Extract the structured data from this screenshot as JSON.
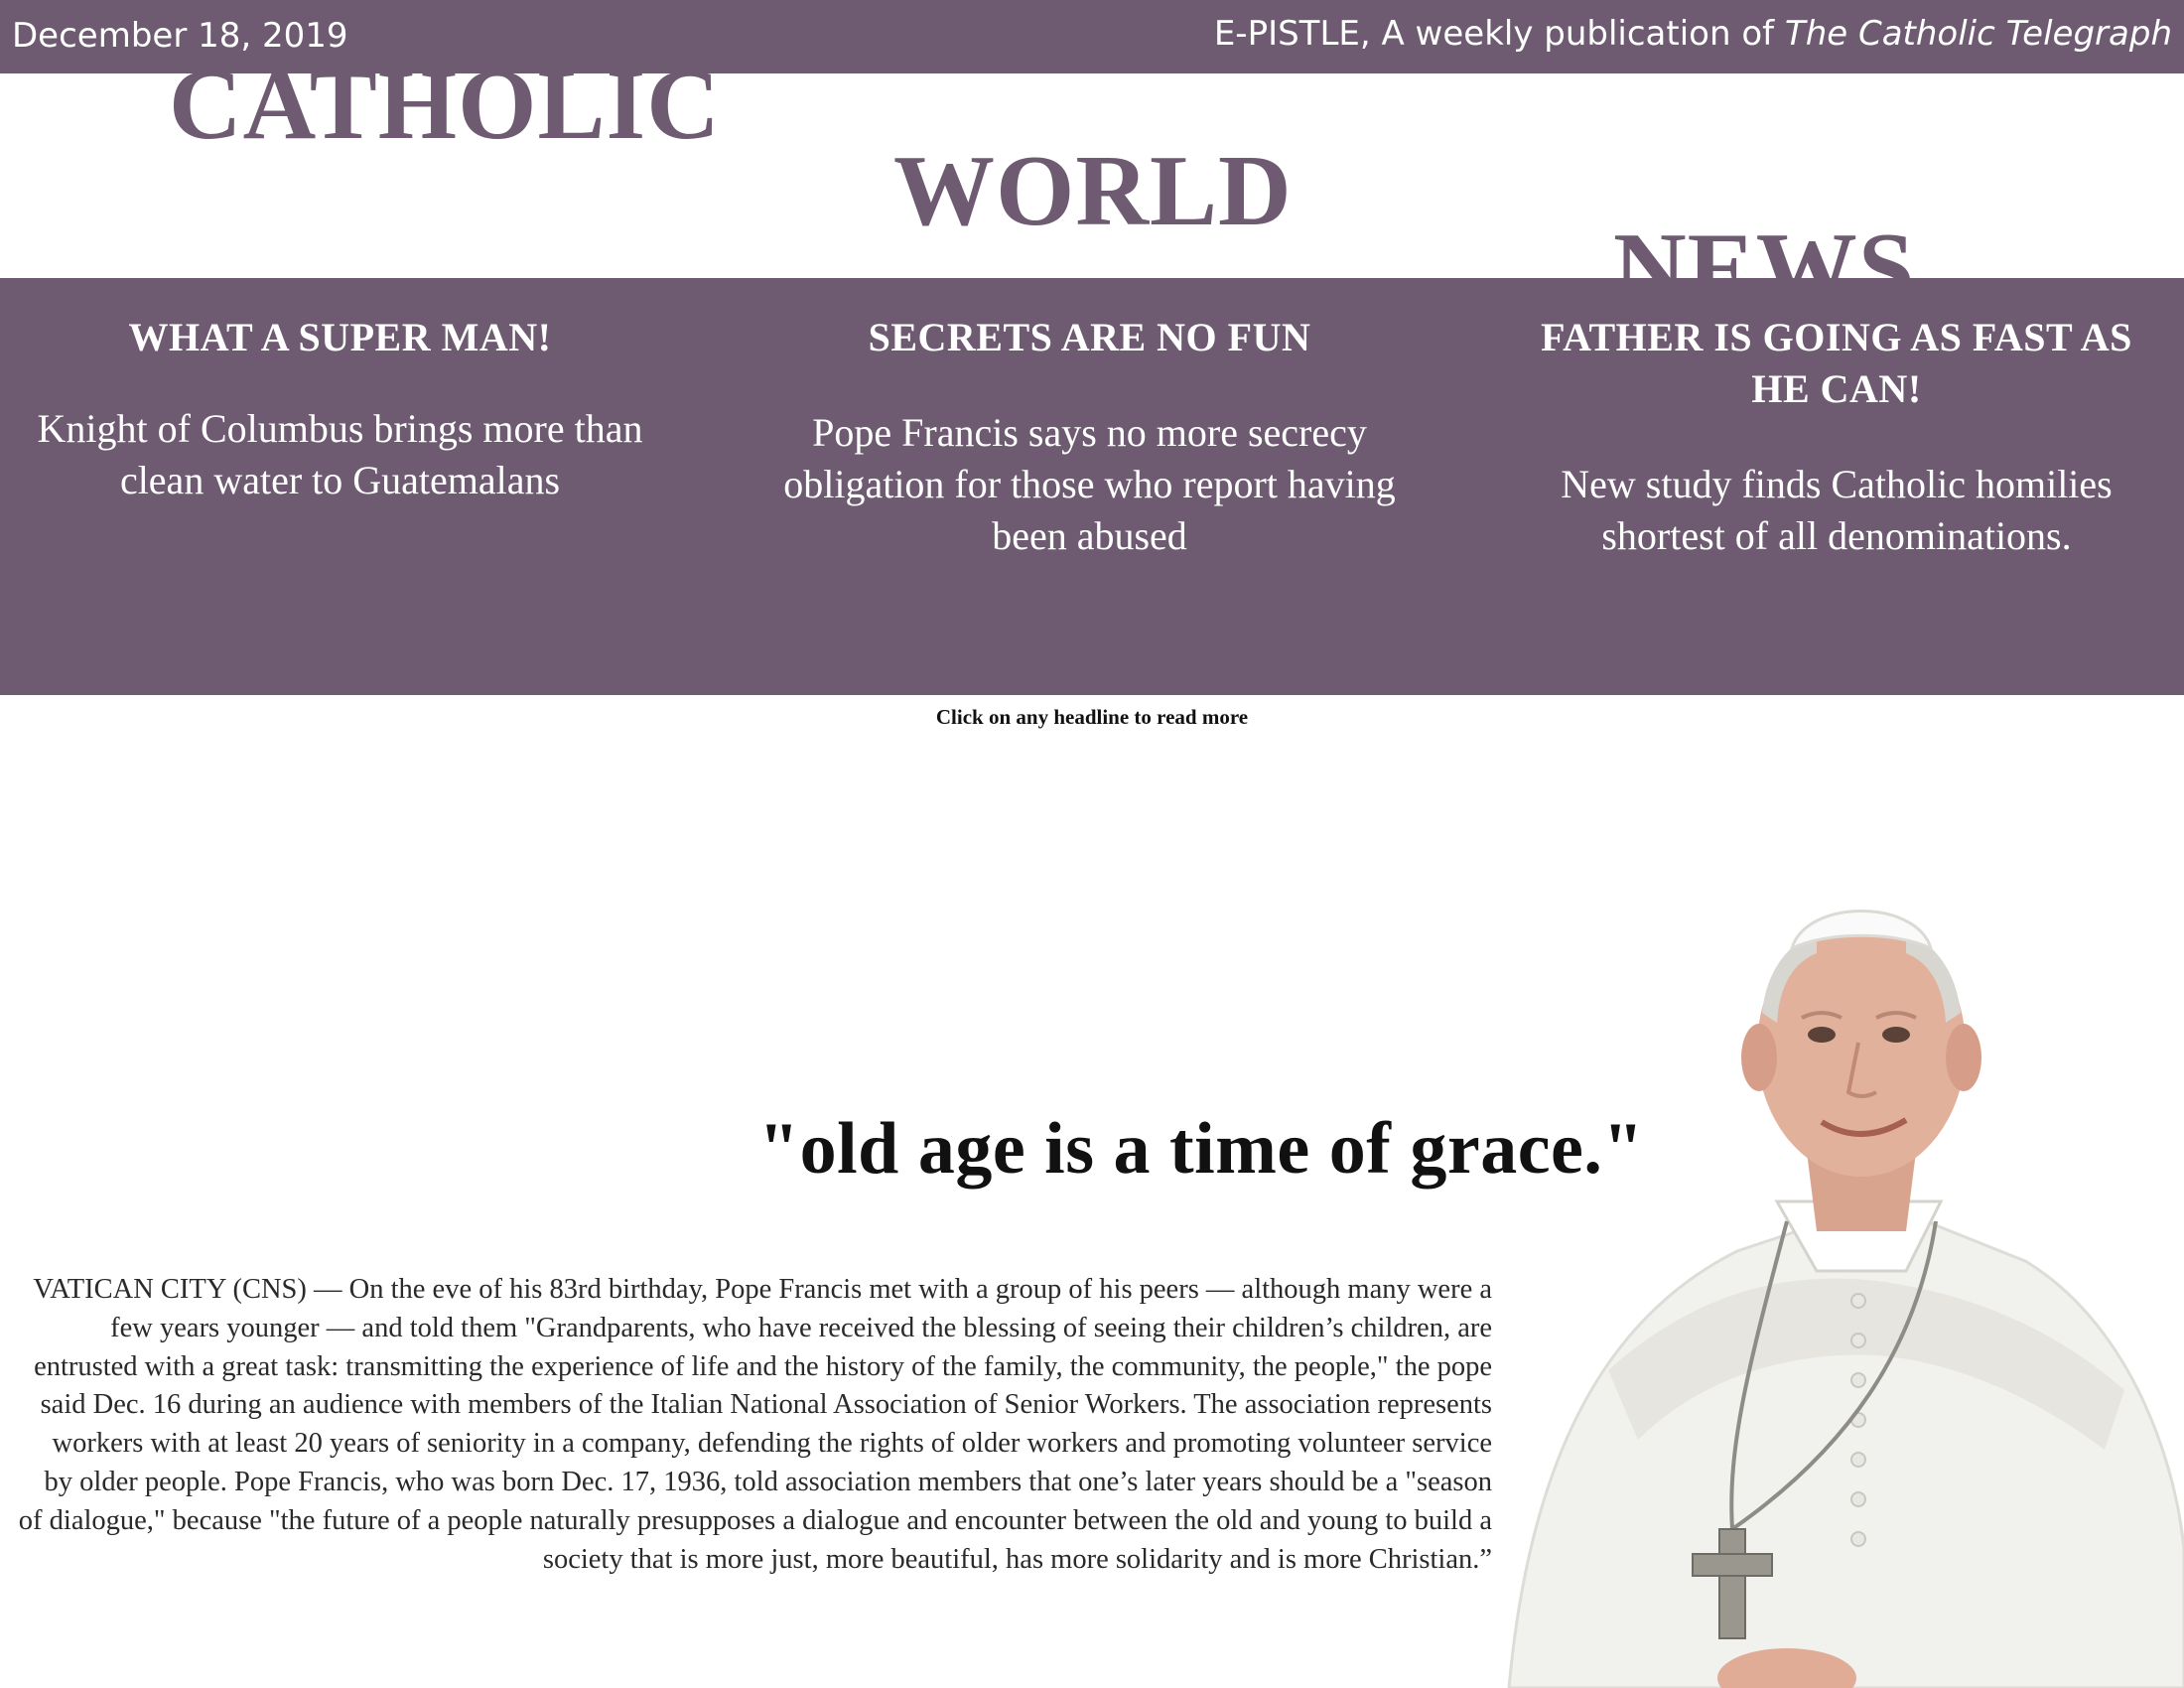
{
  "header": {
    "date": "December 18, 2019",
    "publication_prefix": "E-PISTLE,  A weekly publication of ",
    "publication_name": "The Catholic Telegraph"
  },
  "masthead": {
    "word1": "CATHOLIC",
    "word2": "WORLD",
    "word3": "NEWS"
  },
  "headlines": [
    {
      "title": "WHAT A SUPER MAN!",
      "summary": "Knight of Columbus brings more than clean water to Guatemalans"
    },
    {
      "title": "SECRETS ARE NO FUN",
      "summary": "Pope Francis says no more secrecy obligation for those who report having been abused"
    },
    {
      "title": "FATHER IS GOING AS FAST AS HE CAN!",
      "summary": "New study finds Catholic homilies shortest of all denominations."
    }
  ],
  "click_note": "Click on any headline to read more",
  "feature": {
    "quote": "\"old age is a time of grace.\"",
    "body": "VATICAN CITY (CNS) — On the eve of his 83rd birthday, Pope Francis met with a group of his peers — although many were a few years younger — and told them \"Grandparents, who have received the blessing of seeing their children’s children, are entrusted with a great task: transmitting the experience of life and the history of the family, the community, the people,\" the pope said Dec. 16 during an audience with members of the Italian National Association of Senior Workers. The association represents workers with at least 20 years of seniority in a company, defending the rights of older workers and promoting volunteer service by older people. Pope Francis, who was born Dec. 17, 1936, told association members that one’s later years should be a \"season of dialogue,\" because \"the future of a people naturally presupposes a dialogue and encounter between the old and young to build a society that is more just, more beautiful, has more solidarity and is more Christian.”"
  },
  "colors": {
    "brand_purple": "#6e5b71",
    "text_dark": "#111111",
    "white": "#ffffff"
  }
}
